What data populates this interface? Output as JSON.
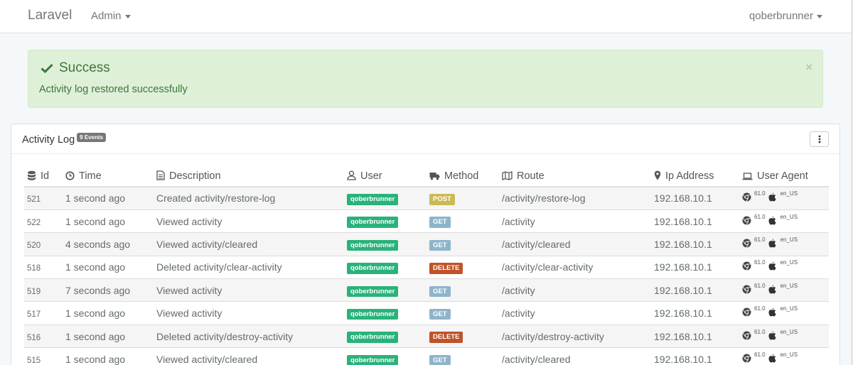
{
  "navbar": {
    "brand": "Laravel",
    "admin": "Admin",
    "user": "qoberbrunner"
  },
  "alert": {
    "title": "Success",
    "message": "Activity log restored successfully",
    "close": "×"
  },
  "panel": {
    "title": "Activity Log",
    "badge": "9 Events"
  },
  "columns": {
    "id": "Id",
    "time": "Time",
    "description": "Description",
    "user": "User",
    "method": "Method",
    "route": "Route",
    "ip": "Ip Address",
    "agent": "User Agent"
  },
  "rows": [
    {
      "id": "521",
      "time": "1 second ago",
      "description": "Created activity/restore-log",
      "user": "qoberbrunner",
      "method": "POST",
      "route": "/activity/restore-log",
      "ip": "192.168.10.1",
      "version": "61.0",
      "locale": "en_US"
    },
    {
      "id": "522",
      "time": "1 second ago",
      "description": "Viewed activity",
      "user": "qoberbrunner",
      "method": "GET",
      "route": "/activity",
      "ip": "192.168.10.1",
      "version": "61.0",
      "locale": "en_US"
    },
    {
      "id": "520",
      "time": "4 seconds ago",
      "description": "Viewed activity/cleared",
      "user": "qoberbrunner",
      "method": "GET",
      "route": "/activity/cleared",
      "ip": "192.168.10.1",
      "version": "61.0",
      "locale": "en_US"
    },
    {
      "id": "518",
      "time": "1 second ago",
      "description": "Deleted activity/clear-activity",
      "user": "qoberbrunner",
      "method": "DELETE",
      "route": "/activity/clear-activity",
      "ip": "192.168.10.1",
      "version": "61.0",
      "locale": "en_US"
    },
    {
      "id": "519",
      "time": "7 seconds ago",
      "description": "Viewed activity",
      "user": "qoberbrunner",
      "method": "GET",
      "route": "/activity",
      "ip": "192.168.10.1",
      "version": "61.0",
      "locale": "en_US"
    },
    {
      "id": "517",
      "time": "1 second ago",
      "description": "Viewed activity",
      "user": "qoberbrunner",
      "method": "GET",
      "route": "/activity",
      "ip": "192.168.10.1",
      "version": "61.0",
      "locale": "en_US"
    },
    {
      "id": "516",
      "time": "1 second ago",
      "description": "Deleted activity/destroy-activity",
      "user": "qoberbrunner",
      "method": "DELETE",
      "route": "/activity/destroy-activity",
      "ip": "192.168.10.1",
      "version": "61.0",
      "locale": "en_US"
    },
    {
      "id": "515",
      "time": "1 second ago",
      "description": "Viewed activity/cleared",
      "user": "qoberbrunner",
      "method": "GET",
      "route": "/activity/cleared",
      "ip": "192.168.10.1",
      "version": "61.0",
      "locale": "en_US"
    }
  ],
  "colors": {
    "success": "#2ab27b",
    "post": "#cbb956",
    "get": "#8eb4cb",
    "delete": "#bf5329"
  }
}
